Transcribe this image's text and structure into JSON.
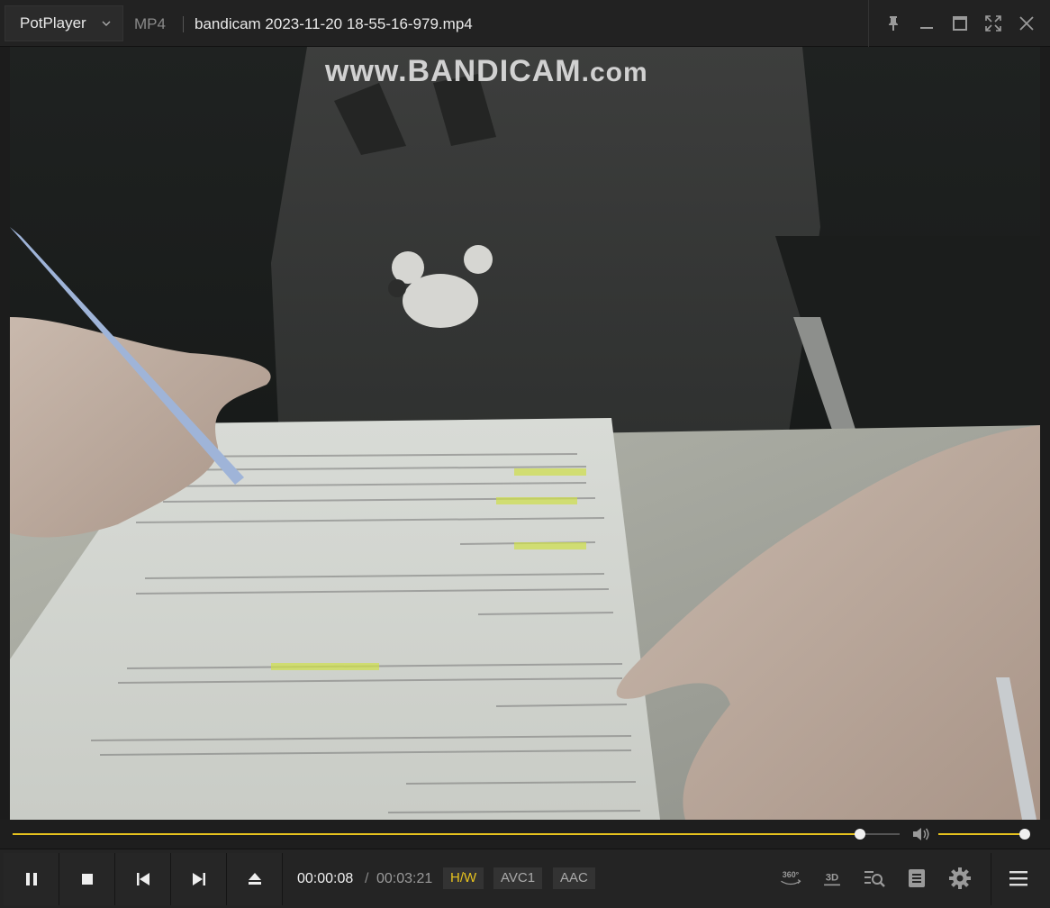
{
  "titlebar": {
    "app_name": "PotPlayer",
    "format": "MP4",
    "filename": "bandicam 2023-11-20 18-55-16-979.mp4"
  },
  "video": {
    "watermark_main": "www.BANDICAM",
    "watermark_suffix": ".com"
  },
  "playback": {
    "current_time": "00:00:08",
    "separator": "/",
    "total_time": "00:03:21",
    "progress_fraction": 0.955,
    "volume_fraction": 1.0
  },
  "badges": {
    "hw": "H/W",
    "video_codec": "AVC1",
    "audio_codec": "AAC"
  },
  "icons": {
    "menu": "chevron-down-icon",
    "pin": "pin-icon",
    "minimize": "minimize-icon",
    "maximize": "maximize-icon",
    "fullscreen": "fullscreen-icon",
    "close": "close-icon",
    "play_pause": "pause-icon",
    "stop": "stop-icon",
    "prev": "previous-icon",
    "next": "next-icon",
    "eject": "eject-icon",
    "vr360": "360-icon",
    "mode3d": "3d-icon",
    "search": "search-list-icon",
    "subtitles": "subtitles-icon",
    "settings": "gear-icon",
    "playlist": "hamburger-menu-icon"
  },
  "colors": {
    "accent": "#e6c21e",
    "background": "#1c1c1c"
  }
}
